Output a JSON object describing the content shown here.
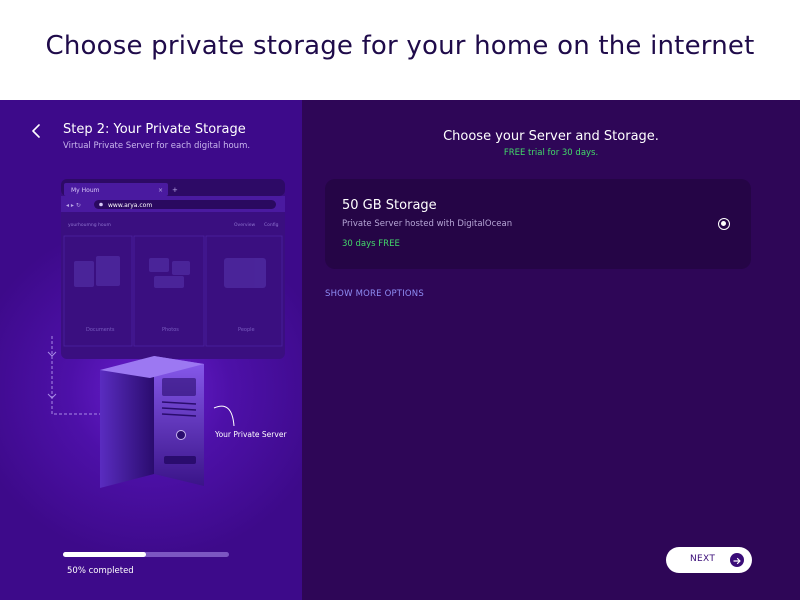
{
  "banner": {
    "title": "Choose private storage for your home on the internet"
  },
  "colors": {
    "accent": "#3a0c78",
    "success": "#43d96a",
    "link": "#8f8df5",
    "left_panel": "#4d10a8",
    "right_panel": "#2e0657"
  },
  "left_panel": {
    "step_title": "Step 2: Your Private Storage",
    "step_subtitle": "Virtual Private Server for each digital houm.",
    "back_icon": "chevron-left-icon",
    "illustration": {
      "browser_tab": "My Houm",
      "browser_url": "www.arya.com",
      "browser_breadcrumb": "yourhoumng houm",
      "browser_links": [
        "Overview",
        "Config"
      ],
      "folders": [
        "Documents",
        "Photos",
        "People"
      ],
      "server_label": "Your Private Server"
    },
    "progress": {
      "value": 0.5,
      "label": "50% completed"
    }
  },
  "right_panel": {
    "title": "Choose your Server and Storage.",
    "subtitle": "FREE trial for 30 days.",
    "option": {
      "title": "50 GB Storage",
      "description": "Private Server hosted with DigitalOcean",
      "note": "30 days FREE",
      "selected": true
    },
    "more_options_label": "SHOW MORE OPTIONS",
    "next_label": "NEXT",
    "next_icon": "arrow-right-icon"
  }
}
